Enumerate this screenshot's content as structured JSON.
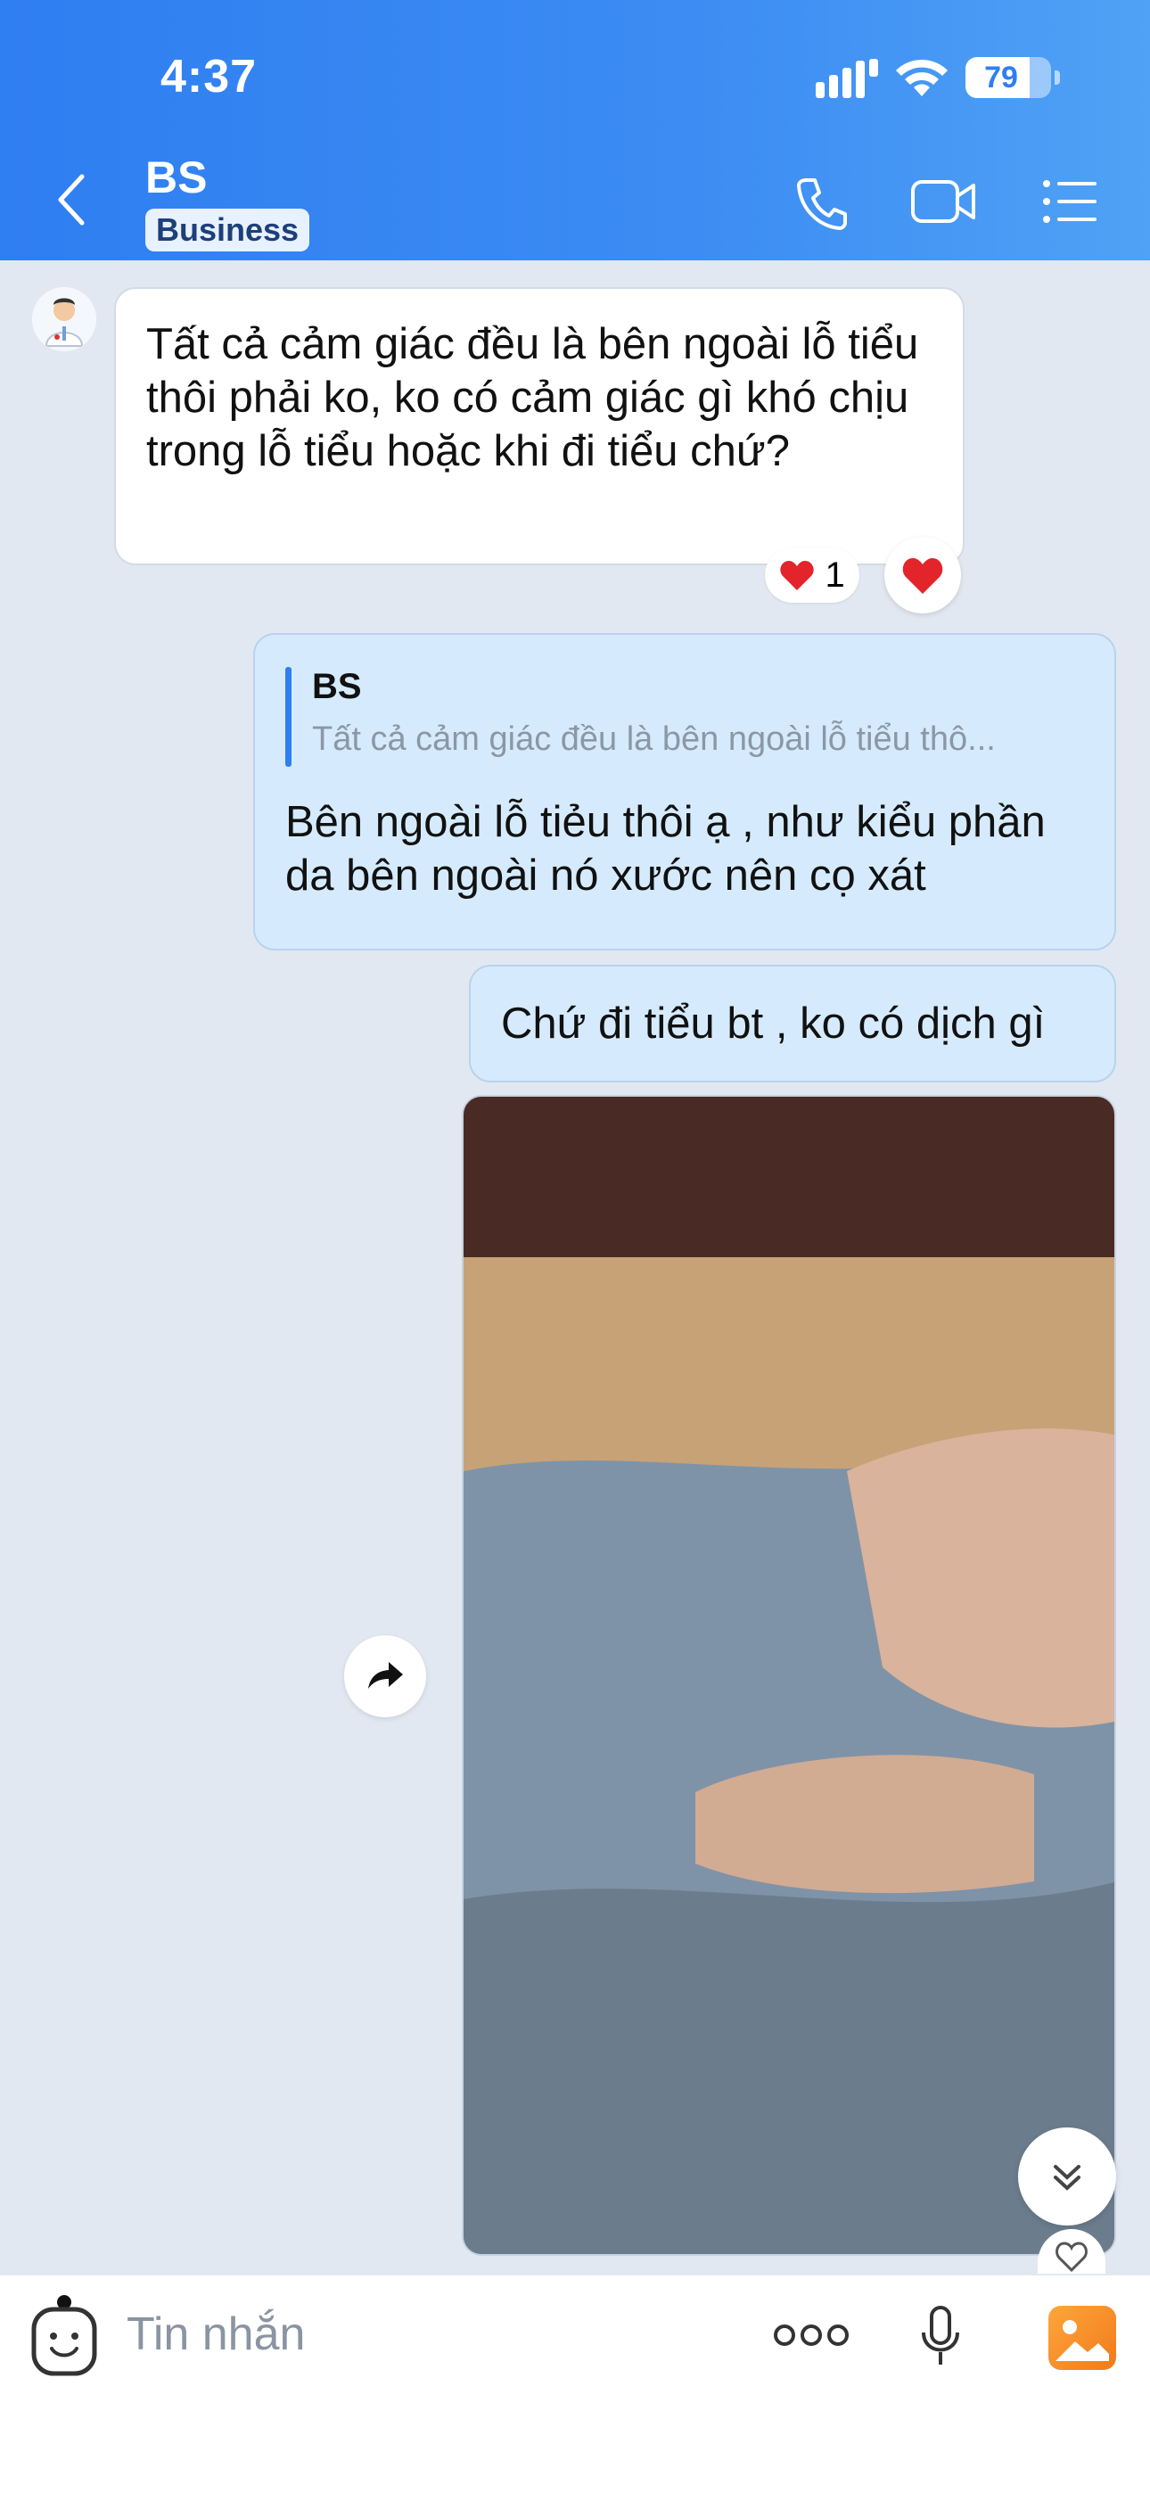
{
  "status_bar": {
    "time": "4:37",
    "battery": "79"
  },
  "header": {
    "title": "BS",
    "badge": "Business",
    "icons": [
      "back-chevron-icon",
      "phone-icon",
      "video-icon",
      "menu-list-icon"
    ]
  },
  "messages": {
    "incoming": {
      "text": "Tất cả cảm giác đều là bên ngoài lỗ tiểu thôi phải ko, ko có cảm giác gì khó chịu trong lỗ tiểu hoặc khi đi tiểu chứ?",
      "reaction_count": "1"
    },
    "reply": {
      "quote_name": "BS",
      "quote_text": "Tất cả cảm giác đều là bên ngoài lỗ tiểu thô...",
      "text": "Bên ngoài lỗ tiẻu thôi ạ , như kiểu phần da bên ngoài nó xước nên cọ xát"
    },
    "short": {
      "text": "Chứ đi tiểu bt , ko có dịch gì"
    }
  },
  "composer": {
    "placeholder": "Tin nhắn"
  },
  "colors": {
    "header_start": "#2f7ef2",
    "header_end": "#4fa2f5",
    "outgoing_bubble": "#d5ebfd",
    "background": "#e2e8f1",
    "heart": "#e3242b"
  }
}
